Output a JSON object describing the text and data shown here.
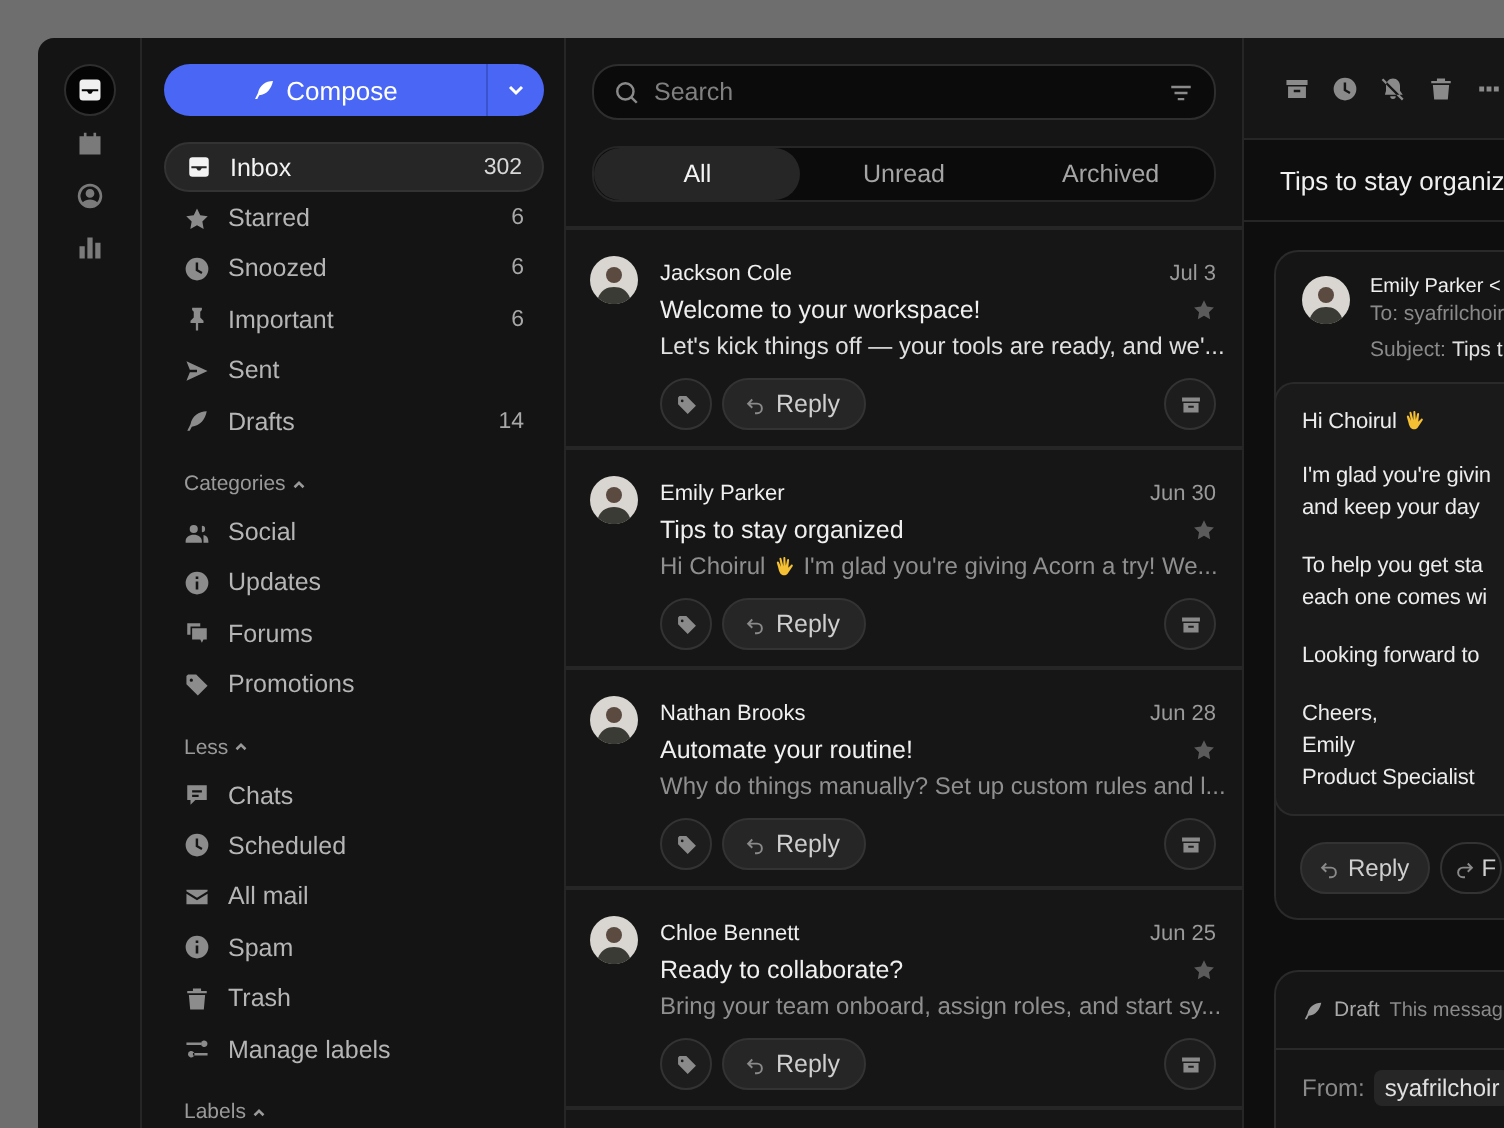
{
  "rail": {
    "items": [
      {
        "selected": true
      },
      {
        "selected": false
      },
      {
        "selected": false
      },
      {
        "selected": false
      }
    ]
  },
  "compose": {
    "label": "Compose"
  },
  "nav": {
    "items": [
      {
        "label": "Inbox",
        "count": "302",
        "selected": true
      },
      {
        "label": "Starred",
        "count": "6",
        "selected": false
      },
      {
        "label": "Snoozed",
        "count": "6",
        "selected": false
      },
      {
        "label": "Important",
        "count": "6",
        "selected": false
      },
      {
        "label": "Sent",
        "selected": false
      },
      {
        "label": "Drafts",
        "count": "14",
        "selected": false
      }
    ]
  },
  "categories": {
    "title": "Categories",
    "expanded": true,
    "items": [
      {
        "label": "Social",
        "selected": false
      },
      {
        "label": "Updates",
        "selected": false
      },
      {
        "label": "Forums",
        "selected": false
      },
      {
        "label": "Promotions",
        "selected": false
      }
    ]
  },
  "less": {
    "title": "Less",
    "expanded": true,
    "items": [
      {
        "label": "Chats",
        "selected": false
      },
      {
        "label": "Scheduled",
        "selected": false
      },
      {
        "label": "All mail",
        "selected": false
      },
      {
        "label": "Spam",
        "selected": false
      },
      {
        "label": "Trash",
        "selected": false
      },
      {
        "label": "Manage labels",
        "selected": false
      }
    ]
  },
  "labels": {
    "title": "Labels",
    "expanded": true
  },
  "search": {
    "placeholder": "Search"
  },
  "tabs": [
    {
      "label": "All",
      "selected": true
    },
    {
      "label": "Unread",
      "selected": false
    },
    {
      "label": "Archived",
      "selected": false
    }
  ],
  "messages": [
    {
      "sender": "Jackson Cole",
      "date": "Jul 3",
      "subject": "Welcome to your workspace!",
      "preview": "Let's kick things off — your tools are ready, and we'...",
      "unread": true,
      "reply": "Reply"
    },
    {
      "sender": "Emily Parker",
      "date": "Jun 30",
      "subject": "Tips to stay organized",
      "greeting": "Hi Choirul",
      "preview": "I'm glad you're giving Acorn a try!  We...",
      "unread": false,
      "reply": "Reply"
    },
    {
      "sender": "Nathan Brooks",
      "date": "Jun 28",
      "subject": "Automate your routine!",
      "preview": "Why do things manually? Set up custom rules and l...",
      "unread": false,
      "reply": "Reply"
    },
    {
      "sender": "Chloe Bennett",
      "date": "Jun 25",
      "subject": "Ready to collaborate?",
      "preview": "Bring your team onboard, assign roles, and start sy...",
      "unread": false,
      "reply": "Reply"
    }
  ],
  "reader": {
    "title": "Tips to stay organiz",
    "from": "Emily Parker <",
    "to": "To: syafrilchoir",
    "subject_label": "Subject:",
    "subject": "Tips t",
    "greeting": "Hi Choirul",
    "paragraphs": [
      [
        "I'm glad you're givin",
        "and keep your day"
      ],
      [
        "To help you get sta",
        "each one comes wi"
      ],
      [
        "Looking forward to"
      ],
      [
        "Cheers,",
        "Emily",
        "Product Specialist"
      ]
    ],
    "reply": "Reply",
    "forward": "F",
    "draft": {
      "label": "Draft",
      "note": "This messag",
      "from_label": "From:",
      "from_value": "syafrilchoir"
    }
  }
}
